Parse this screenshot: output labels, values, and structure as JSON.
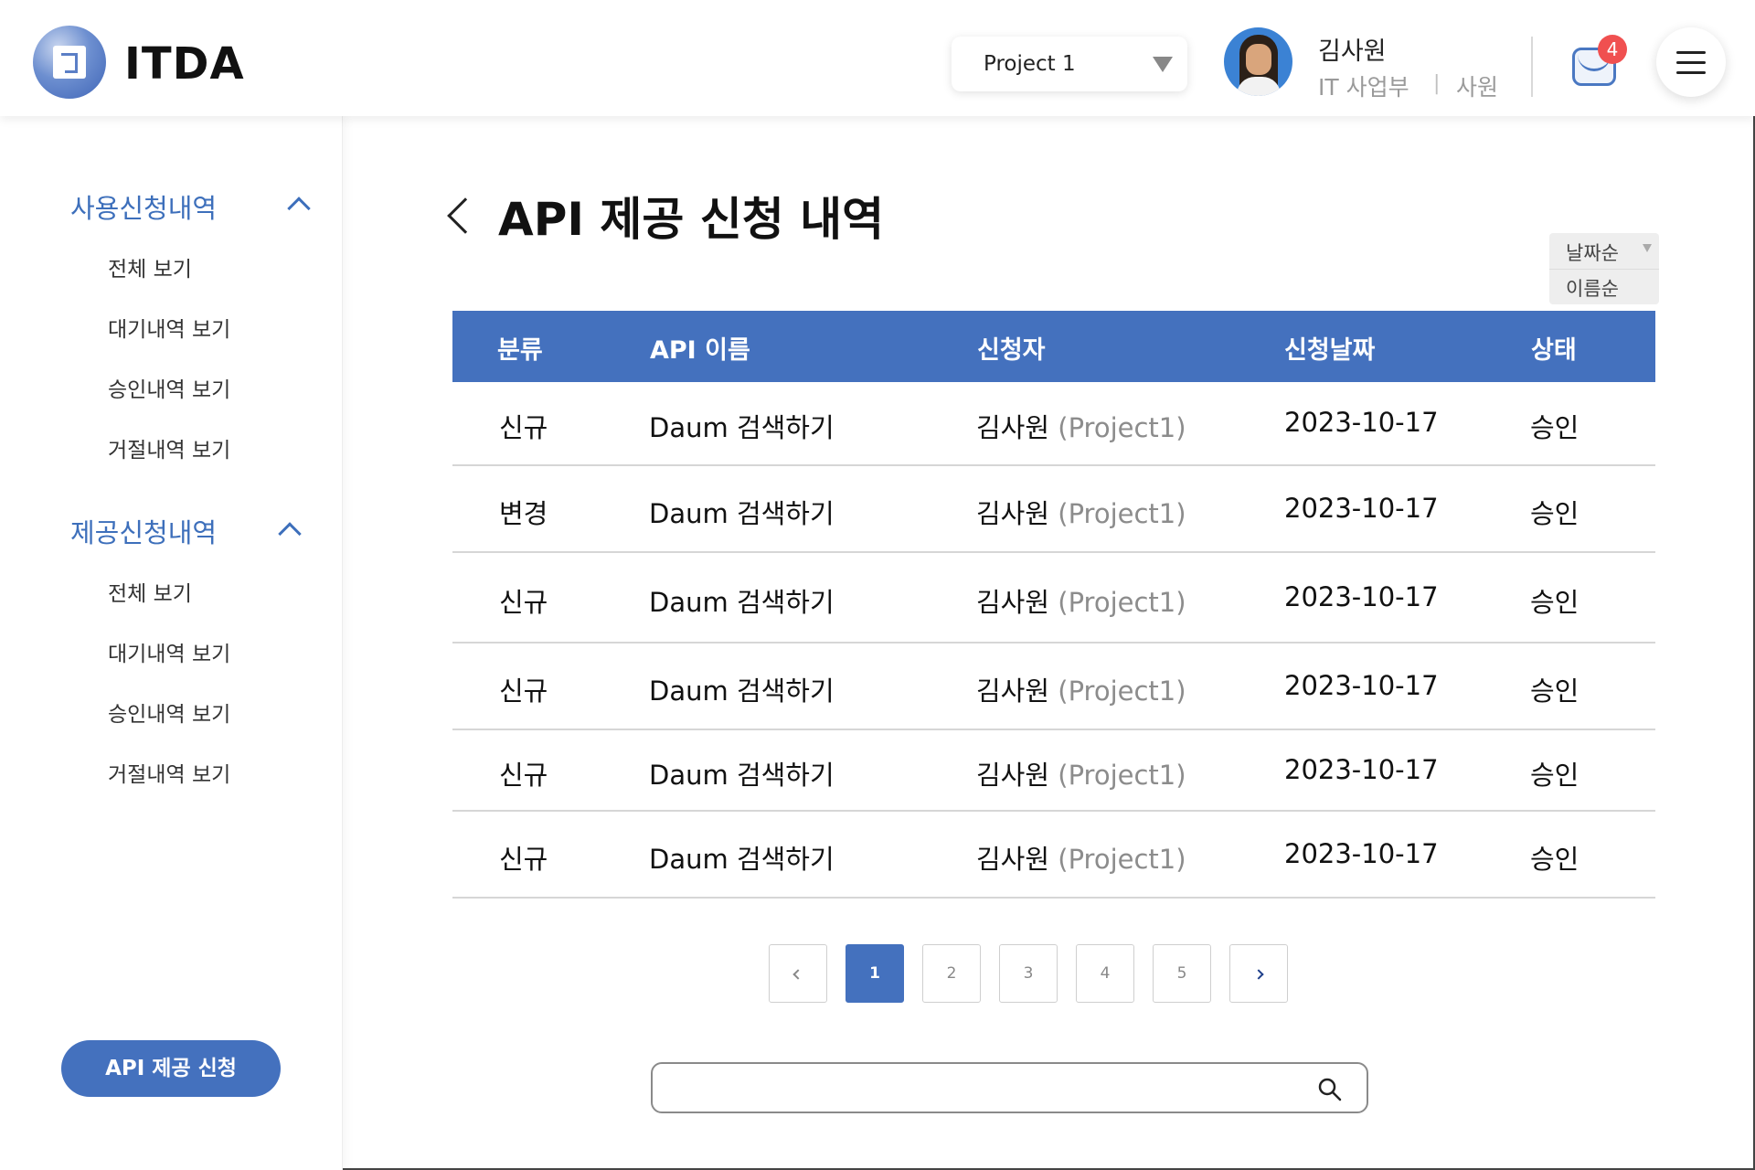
{
  "header": {
    "logo_text": "ITDA",
    "project_select": "Project 1",
    "user_name": "김사원",
    "user_dept": "IT 사업부",
    "user_sep": "|",
    "user_rank": "사원",
    "mail_count": "4"
  },
  "sidebar": {
    "sections": [
      {
        "title": "사용신청내역",
        "items": [
          "전체 보기",
          "대기내역 보기",
          "승인내역 보기",
          "거절내역 보기"
        ]
      },
      {
        "title": "제공신청내역",
        "items": [
          "전체 보기",
          "대기내역 보기",
          "승인내역 보기",
          "거절내역 보기"
        ]
      }
    ],
    "api_button": "API 제공 신청"
  },
  "main": {
    "title": "API 제공 신청 내역",
    "sort_options": [
      "날짜순",
      "이름순"
    ],
    "table": {
      "headers": [
        "분류",
        "API 이름",
        "신청자",
        "신청날짜",
        "상태"
      ],
      "rows": [
        {
          "type": "신규",
          "api": "Daum 검색하기",
          "applicant": "김사원",
          "project": "(Project1)",
          "date": "2023-10-17",
          "status": "승인"
        },
        {
          "type": "변경",
          "api": "Daum 검색하기",
          "applicant": "김사원",
          "project": "(Project1)",
          "date": "2023-10-17",
          "status": "승인"
        },
        {
          "type": "신규",
          "api": "Daum 검색하기",
          "applicant": "김사원",
          "project": "(Project1)",
          "date": "2023-10-17",
          "status": "승인"
        },
        {
          "type": "신규",
          "api": "Daum 검색하기",
          "applicant": "김사원",
          "project": "(Project1)",
          "date": "2023-10-17",
          "status": "승인"
        },
        {
          "type": "신규",
          "api": "Daum 검색하기",
          "applicant": "김사원",
          "project": "(Project1)",
          "date": "2023-10-17",
          "status": "승인"
        },
        {
          "type": "신규",
          "api": "Daum 검색하기",
          "applicant": "김사원",
          "project": "(Project1)",
          "date": "2023-10-17",
          "status": "승인"
        }
      ]
    },
    "pagination": {
      "pages": [
        "1",
        "2",
        "3",
        "4",
        "5"
      ],
      "current": "1"
    },
    "search": {
      "value": "",
      "placeholder": ""
    }
  },
  "colors": {
    "accent": "#4471be",
    "badge": "#f05050"
  },
  "icons": [
    "logo-icon",
    "chevron-down-icon",
    "avatar",
    "mail-icon",
    "menu-icon",
    "chevron-up-icon",
    "back-icon",
    "search-icon",
    "chevron-left-icon",
    "chevron-right-icon"
  ]
}
